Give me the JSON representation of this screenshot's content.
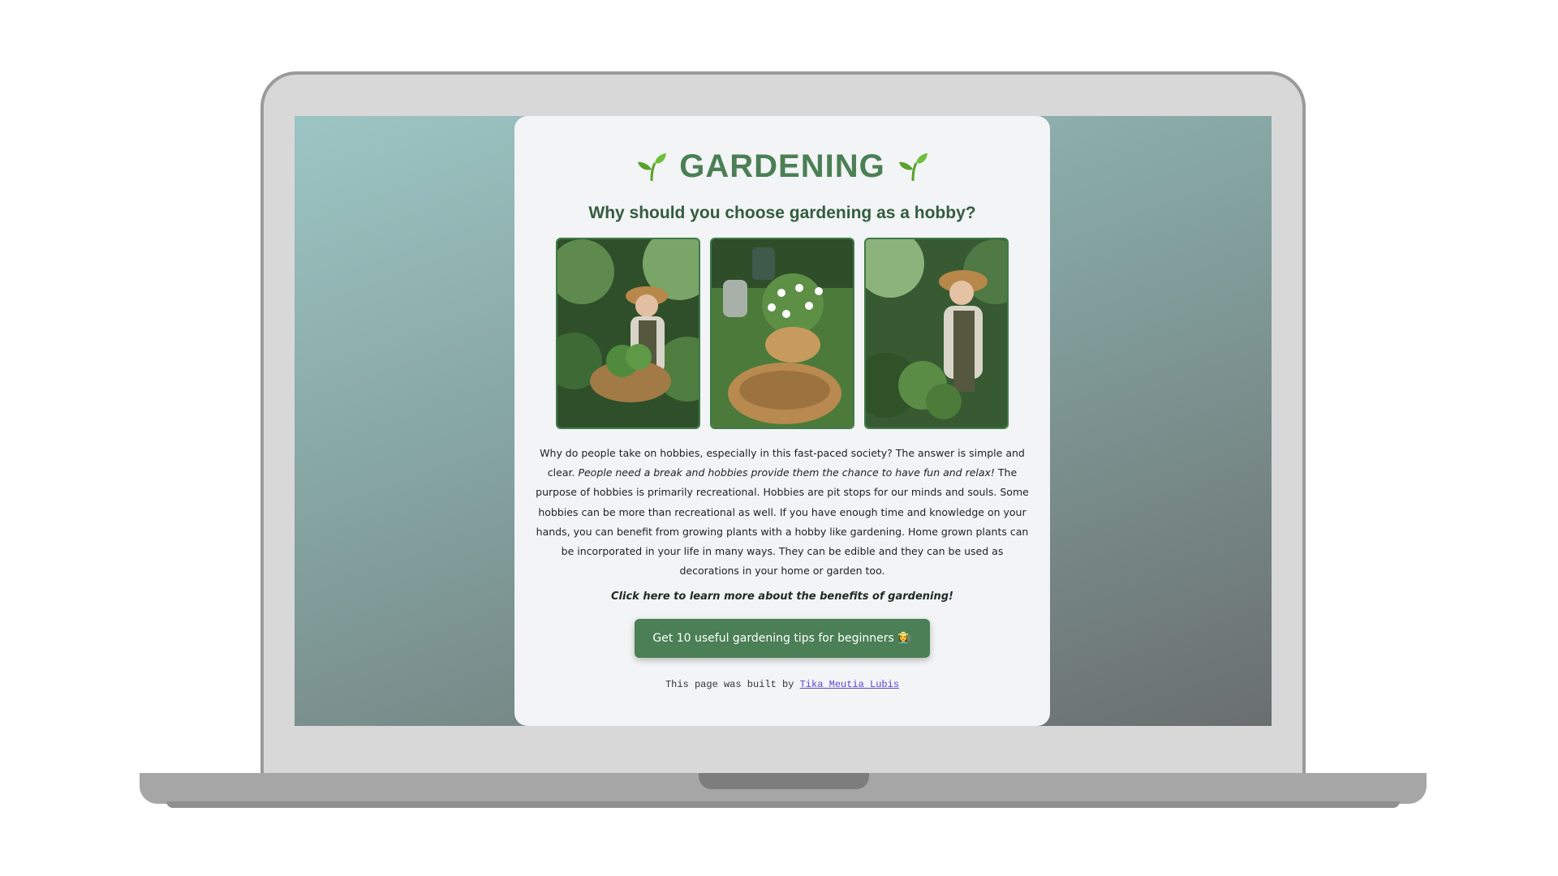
{
  "page": {
    "title": "GARDENING",
    "subtitle": "Why should you choose gardening as a hobby?",
    "description_parts": [
      "Why do people take on hobbies, especially in this fast-paced society? The answer is simple and clear. ",
      "People need a break and hobbies provide them the chance to have fun and relax!",
      " The purpose of hobbies is primarily recreational. Hobbies are pit stops for our minds and souls. Some hobbies can be more than recreational as well. If you have enough time and knowledge on your hands, you can benefit from growing plants with a hobby like gardening. Home grown plants can be incorporated in your life in many ways. They can be edible and they can be used as decorations in your home or garden too."
    ],
    "learn_more_link": "Click here to learn more about the benefits of gardening!",
    "tips_button": "Get 10 useful gardening tips for beginners 👩‍🌾",
    "footer_text": "This page was built by ",
    "footer_author": "Tika Meutia Lubis"
  },
  "images": [
    {
      "icon": "gardener-with-basket-photo"
    },
    {
      "icon": "daisy-basket-photo"
    },
    {
      "icon": "gardener-smiling-photo"
    }
  ],
  "colors": {
    "accent": "#4b7f55",
    "subtitle": "#345c40",
    "link": "#5b46d6",
    "card": "#f2f4f5"
  }
}
